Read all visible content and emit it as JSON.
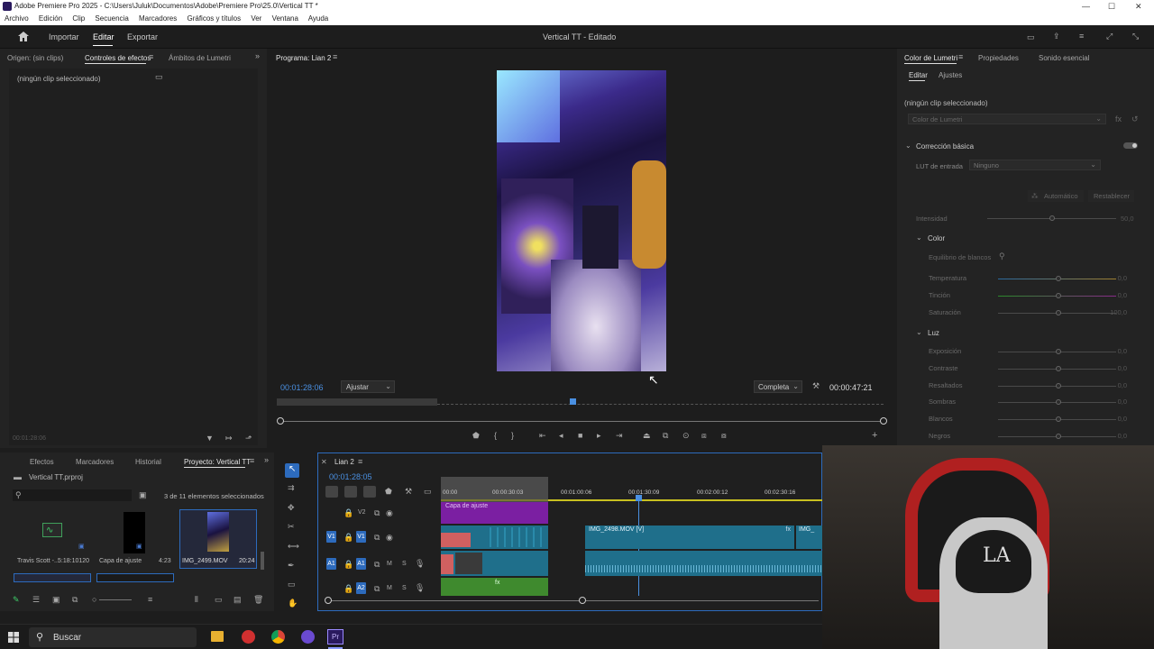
{
  "titlebar": {
    "title": "Adobe Premiere Pro 2025 - C:\\Users\\Juluk\\Documentos\\Adobe\\Premiere Pro\\25.0\\Vertical TT *"
  },
  "menubar": [
    "Archivo",
    "Edición",
    "Clip",
    "Secuencia",
    "Marcadores",
    "Gráficos y títulos",
    "Ver",
    "Ventana",
    "Ayuda"
  ],
  "workspace": {
    "import": "Importar",
    "edit": "Editar",
    "export": "Exportar",
    "title": "Vertical TT - Editado"
  },
  "source_panel": {
    "tab_origin": "Origen: (sin clips)",
    "tab_effects": "Controles de efectos",
    "tab_lumetri_scopes": "Ámbitos de Lumetri",
    "no_clip": "(ningún clip seleccionado)",
    "timecode": "00:01:28:06"
  },
  "program": {
    "tab": "Programa: Lian 2",
    "timecode": "00:01:28:06",
    "fit": "Ajustar",
    "quality": "Completa",
    "duration": "00:00:47:21"
  },
  "lumetri": {
    "tab_color": "Color de Lumetri",
    "tab_props": "Propiedades",
    "tab_sound": "Sonido esencial",
    "sub_edit": "Editar",
    "sub_adjust": "Ajustes",
    "no_clip": "(ningún clip seleccionado)",
    "dropdown": "Color de Lumetri",
    "section_basic": "Corrección básica",
    "lut_label": "LUT de entrada",
    "lut_value": "Ninguno",
    "auto": "Automático",
    "reset": "Restablecer",
    "intensity": "Intensidad",
    "intensity_val": "50,0",
    "color_section": "Color",
    "wb": "Equilibrio de blancos",
    "light_section": "Luz"
  },
  "lumetri_sliders": [
    {
      "label": "Temperatura",
      "value": "0,0"
    },
    {
      "label": "Tinción",
      "value": "0,0"
    },
    {
      "label": "Saturación",
      "value": "100,0"
    },
    {
      "label": "Exposición",
      "value": "0,0"
    },
    {
      "label": "Contraste",
      "value": "0,0"
    },
    {
      "label": "Resaltados",
      "value": "0,0"
    },
    {
      "label": "Sombras",
      "value": "0,0"
    },
    {
      "label": "Blancos",
      "value": "0,0"
    },
    {
      "label": "Negros",
      "value": "0,0"
    }
  ],
  "project": {
    "tab_effects": "Efectos",
    "tab_markers": "Marcadores",
    "tab_history": "Historial",
    "tab_project": "Proyecto: Vertical TT",
    "file": "Vertical TT.prproj",
    "selected": "3 de 11 elementos seleccionados",
    "items": [
      {
        "name": "Travis Scott -...",
        "dur": "5:18:10120"
      },
      {
        "name": "Capa de ajuste",
        "dur": "4:23"
      },
      {
        "name": "IMG_2499.MOV",
        "dur": "20:24"
      }
    ]
  },
  "timeline": {
    "tab": "Lian 2",
    "timecode": "00:01:28:05",
    "ruler": [
      "00:00",
      "00:00:30:03",
      "00:01:00:06",
      "00:01:30:09",
      "00:02:00:12",
      "00:02:30:16"
    ],
    "tracks": [
      "V2",
      "V1",
      "A1",
      "A2"
    ],
    "adjust_clip": "Capa de ajuste",
    "video_clip": "IMG_2498.MOV [V]",
    "video_clip2": "IMG_"
  },
  "taskbar": {
    "search": "Buscar"
  },
  "colors": {
    "accent": "#2d6bbd",
    "timecode": "#4a90e2",
    "purple_clip": "#7b1fa2",
    "teal_clip": "#1f6f8b",
    "green_audio": "#3f8a2e"
  }
}
